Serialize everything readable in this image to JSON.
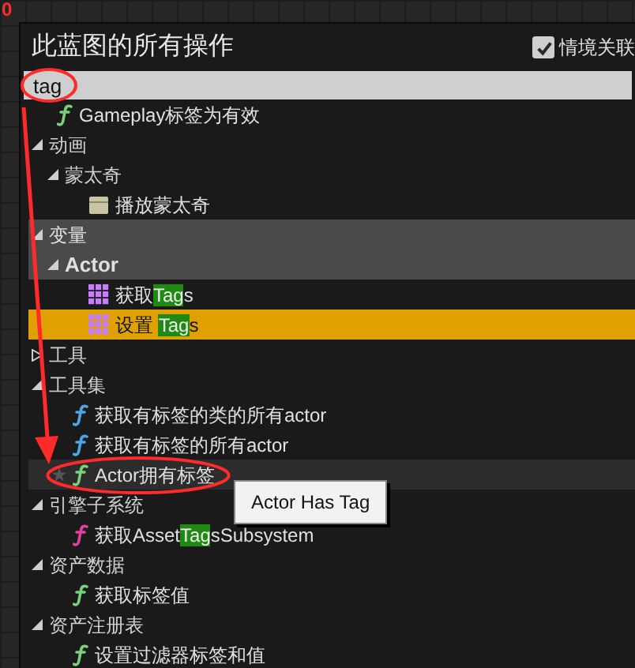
{
  "annotations": {
    "step_number": "0"
  },
  "panel": {
    "title": "此蓝图的所有操作",
    "context_sensitive": {
      "label": "情境关联",
      "checked": true
    }
  },
  "search": {
    "value": "tag"
  },
  "tree": [
    {
      "label": "Gameplay标签为有效",
      "kind": "function",
      "color": "#7ad17a",
      "selected": false,
      "hovered": false
    },
    {
      "label": "动画",
      "expanded": true,
      "section_header": false,
      "children": [
        {
          "label": "蒙太奇",
          "expanded": true,
          "section_header": false,
          "children": [
            {
              "label": "播放蒙太奇",
              "kind": "montage",
              "selected": false,
              "hovered": false
            }
          ]
        }
      ]
    },
    {
      "label": "变量",
      "expanded": true,
      "section_header": true,
      "bold": false,
      "children": [
        {
          "label": "Actor",
          "expanded": true,
          "section_header": true,
          "bold": true,
          "children": [
            {
              "segments": [
                {
                  "text": "获取",
                  "highlight": false
                },
                {
                  "text": "Tag",
                  "highlight": true
                },
                {
                  "text": "s",
                  "highlight": false
                }
              ],
              "kind": "variable",
              "selected": false,
              "hovered": false
            },
            {
              "segments": [
                {
                  "text": "设置 ",
                  "highlight": false
                },
                {
                  "text": "Tag",
                  "highlight": true
                },
                {
                  "text": "s",
                  "highlight": false
                }
              ],
              "kind": "variable",
              "selected": true,
              "hovered": false
            }
          ]
        }
      ]
    },
    {
      "label": "工具",
      "expanded": false,
      "section_header": false
    },
    {
      "label": "工具集",
      "expanded": true,
      "section_header": false,
      "children": [
        {
          "label": "获取有标签的类的所有actor",
          "kind": "function",
          "color": "#4aa8e8",
          "selected": false,
          "hovered": false
        },
        {
          "label": "获取有标签的所有actor",
          "kind": "function",
          "color": "#4aa8e8",
          "selected": false,
          "hovered": false
        },
        {
          "label": "Actor拥有标签",
          "kind": "function",
          "color": "#7ad17a",
          "selected": false,
          "hovered": true,
          "tooltip": "Actor Has Tag"
        }
      ]
    },
    {
      "label": "引擎子系统",
      "expanded": true,
      "section_header": false,
      "children": [
        {
          "segments": [
            {
              "text": "获取Asset",
              "highlight": false
            },
            {
              "text": "Tag",
              "highlight": true
            },
            {
              "text": "sSubsystem",
              "highlight": false
            }
          ],
          "kind": "function",
          "color": "#e040a0",
          "selected": false,
          "hovered": false
        }
      ]
    },
    {
      "label": "资产数据",
      "expanded": true,
      "section_header": false,
      "children": [
        {
          "label": "获取标签值",
          "kind": "function",
          "color": "#7ad17a",
          "selected": false,
          "hovered": false
        }
      ]
    },
    {
      "label": "资产注册表",
      "expanded": true,
      "section_header": false,
      "children": [
        {
          "label": "设置过滤器标签和值",
          "kind": "function",
          "color": "#7ad17a",
          "selected": false,
          "hovered": false
        }
      ]
    }
  ]
}
